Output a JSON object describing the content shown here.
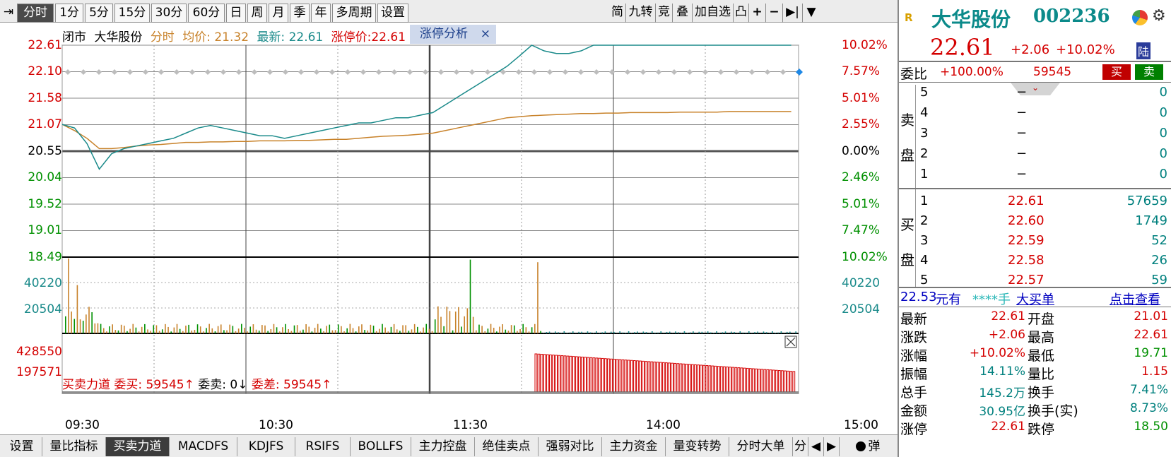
{
  "toolbar": {
    "period_tabs": [
      "分时",
      "1分",
      "5分",
      "15分",
      "30分",
      "60分",
      "日",
      "周",
      "月",
      "季",
      "年",
      "多周期",
      "设置"
    ],
    "right_tools": [
      "简",
      "九转",
      "竞",
      "叠",
      "加自选",
      "凸",
      "+",
      "−",
      "▶|",
      "▼"
    ]
  },
  "chart": {
    "status": "闭市",
    "stock_name": "大华股份",
    "mode": "分时",
    "avg_label": "均价: 21.32",
    "latest_label": "最新: 22.61",
    "limit_label": "涨停价:22.61",
    "limit_tab": "涨停分析",
    "close_x": "×",
    "price_labels_left": [
      "22.61",
      "22.10",
      "21.58",
      "21.07",
      "20.55",
      "20.04",
      "19.52",
      "19.01",
      "18.49"
    ],
    "pct_labels_right": [
      "10.02%",
      "7.57%",
      "5.01%",
      "2.55%",
      "0.00%",
      "2.46%",
      "5.01%",
      "7.47%",
      "10.02%"
    ],
    "volume_labels_left": [
      "40220",
      "20504"
    ],
    "volume_labels_right": [
      "40220",
      "20504"
    ],
    "force_labels_left": [
      "428550",
      "197571"
    ],
    "force_info": {
      "title": "买卖力道",
      "bid": "委买: 59545↑",
      "ask": "委卖: 0↓",
      "diff": "委差: 59545↑"
    },
    "time_labels": [
      "09:30",
      "10:30",
      "11:30",
      "14:00",
      "15:00"
    ],
    "colors": {
      "price_line": "#1a8a8a",
      "avg_line": "#c8822a",
      "up": "#d40000",
      "down": "#009000",
      "grid": "#888888"
    }
  },
  "chart_data": {
    "type": "line",
    "title": "",
    "prev_close": 20.55,
    "ylim": [
      18.49,
      22.61
    ],
    "x": [
      "09:30",
      "10:30",
      "11:30",
      "14:00",
      "15:00"
    ],
    "series": [
      {
        "name": "",
        "values": [
          21.07,
          21.0,
          20.7,
          20.2,
          20.5,
          20.6,
          20.65,
          20.7,
          20.75,
          20.8,
          20.9,
          21.0,
          21.05,
          21.0,
          20.95,
          20.9,
          20.85,
          20.85,
          20.8,
          20.85,
          20.9,
          20.95,
          21.0,
          21.05,
          21.1,
          21.1,
          21.15,
          21.2,
          21.2,
          21.25,
          21.3,
          21.45,
          21.6,
          21.75,
          21.9,
          22.05,
          22.2,
          22.4,
          22.61,
          22.5,
          22.45,
          22.45,
          22.5,
          22.61,
          22.61,
          22.61,
          22.61,
          22.61,
          22.61,
          22.61,
          22.61,
          22.61,
          22.61,
          22.61,
          22.61,
          22.61,
          22.61,
          22.61,
          22.61,
          22.61
        ]
      },
      {
        "name": "",
        "values": [
          21.07,
          20.95,
          20.8,
          20.6,
          20.6,
          20.62,
          20.65,
          20.67,
          20.68,
          20.7,
          20.72,
          20.72,
          20.73,
          20.73,
          20.74,
          20.74,
          20.75,
          20.75,
          20.75,
          20.76,
          20.76,
          20.77,
          20.78,
          20.78,
          20.8,
          20.82,
          20.84,
          20.85,
          20.86,
          20.88,
          20.9,
          20.95,
          21.0,
          21.05,
          21.1,
          21.15,
          21.2,
          21.22,
          21.24,
          21.25,
          21.26,
          21.27,
          21.28,
          21.28,
          21.29,
          21.29,
          21.3,
          21.3,
          21.3,
          21.3,
          21.31,
          21.31,
          21.31,
          21.31,
          21.32,
          21.32,
          21.32,
          21.32,
          21.32,
          21.32
        ]
      }
    ],
    "volume_ylim": [
      0,
      40220
    ]
  },
  "bottom_tabs": [
    "设置",
    "量比指标",
    "买卖力道",
    "MACDFS",
    "KDJFS",
    "RSIFS",
    "BOLLFS",
    "主力控盘",
    "绝佳卖点",
    "强弱对比",
    "主力资金",
    "量变转势",
    "分时大单",
    "分",
    "◀",
    "▶",
    "弹"
  ],
  "quote": {
    "r_badge": "R",
    "name": "大华股份",
    "code": "002236",
    "price": "22.61",
    "change": "+2.06",
    "pct": "+10.02%",
    "tag": "陆",
    "wei_label": "委比",
    "wei_ratio": "+100.00%",
    "wei_diff": "59545",
    "buy_btn": "买",
    "sell_btn": "卖",
    "sell_side_label": [
      "卖",
      "盘"
    ],
    "buy_side_label": [
      "买",
      "盘"
    ],
    "asks": [
      {
        "level": "5",
        "price": "−",
        "vol": "0"
      },
      {
        "level": "4",
        "price": "−",
        "vol": "0"
      },
      {
        "level": "3",
        "price": "−",
        "vol": "0"
      },
      {
        "level": "2",
        "price": "−",
        "vol": "0"
      },
      {
        "level": "1",
        "price": "−",
        "vol": "0"
      }
    ],
    "bids": [
      {
        "level": "1",
        "price": "22.61",
        "vol": "57659"
      },
      {
        "level": "2",
        "price": "22.60",
        "vol": "1749"
      },
      {
        "level": "3",
        "price": "22.59",
        "vol": "52"
      },
      {
        "level": "4",
        "price": "22.58",
        "vol": "26"
      },
      {
        "level": "5",
        "price": "22.57",
        "vol": "59"
      }
    ],
    "big_order": {
      "price": "22.53",
      "unit": "元有",
      "qty": "****手",
      "label": "大买单",
      "link": "点击查看"
    },
    "stats": [
      {
        "l1": "最新",
        "v1": "22.61",
        "c1": "red",
        "l2": "开盘",
        "v2": "21.01",
        "c2": "red"
      },
      {
        "l1": "涨跌",
        "v1": "+2.06",
        "c1": "red",
        "l2": "最高",
        "v2": "22.61",
        "c2": "red"
      },
      {
        "l1": "涨幅",
        "v1": "+10.02%",
        "c1": "red",
        "l2": "最低",
        "v2": "19.71",
        "c2": "green"
      },
      {
        "l1": "振幅",
        "v1": "14.11%",
        "c1": "teal",
        "l2": "量比",
        "v2": "1.15",
        "c2": "red"
      },
      {
        "l1": "总手",
        "v1": "145.2万",
        "c1": "teal",
        "l2": "换手",
        "v2": "7.41%",
        "c2": "teal"
      },
      {
        "l1": "金额",
        "v1": "30.95亿",
        "c1": "teal",
        "l2": "换手(实)",
        "v2": "8.73%",
        "c2": "teal"
      },
      {
        "l1": "涨停",
        "v1": "22.61",
        "c1": "red",
        "l2": "跌停",
        "v2": "18.50",
        "c2": "green"
      }
    ]
  }
}
